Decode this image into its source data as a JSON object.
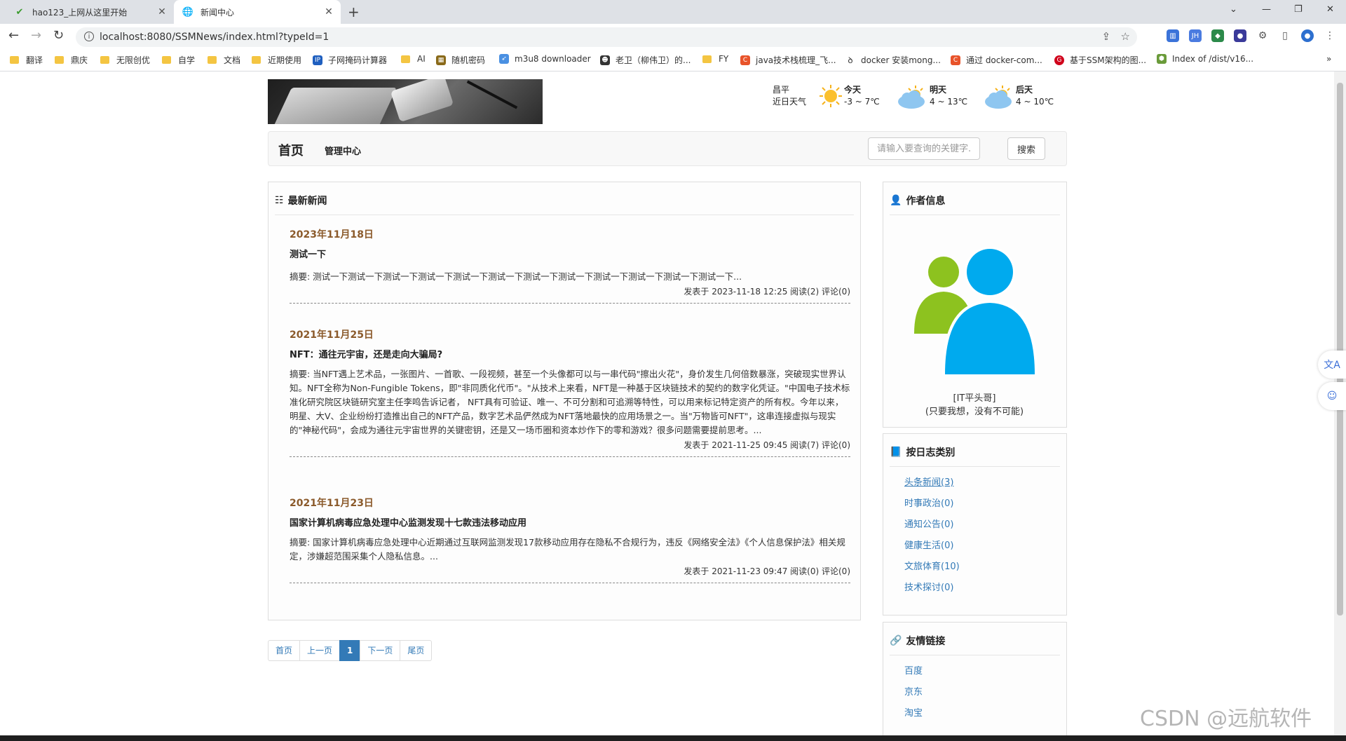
{
  "browser": {
    "tabs": [
      {
        "title": "hao123_上网从这里开始",
        "active": false
      },
      {
        "title": "新闻中心",
        "active": true
      }
    ],
    "url": "localhost:8080/SSMNews/index.html?typeId=1",
    "bookmarks": [
      "翻译",
      "鼎庆",
      "无限创优",
      "自学",
      "文档",
      "近期使用",
      "子网掩码计算器",
      "AI",
      "随机密码",
      "m3u8 downloader",
      "老卫（柳伟卫）的...",
      "FY",
      "java技术栈梳理_飞...",
      "docker 安装mong...",
      "通过 docker-com...",
      "基于SSM架构的图...",
      "Index of /dist/v16..."
    ],
    "bookmark_more": "»"
  },
  "weather": {
    "location": "昌平",
    "subtitle": "近日天气",
    "days": [
      {
        "label": "今天",
        "range": "-3 ~ 7℃",
        "icon": "sun-icon"
      },
      {
        "label": "明天",
        "range": "4 ~ 13℃",
        "icon": "cloudy-icon"
      },
      {
        "label": "后天",
        "range": "4 ~ 10℃",
        "icon": "cloudy-icon"
      }
    ]
  },
  "nav": {
    "home": "首页",
    "admin": "管理中心",
    "search_placeholder": "请输入要查询的关键字...",
    "search_button": "搜索"
  },
  "latest": {
    "heading": "最新新闻",
    "items": [
      {
        "date": "2023年11月18日",
        "title": "测试一下",
        "summary": "摘要: 测试一下测试一下测试一下测试一下测试一下测试一下测试一下测试一下测试一下测试一下测试一下测试一下...",
        "meta": "发表于 2023-11-18 12:25 阅读(2) 评论(0)"
      },
      {
        "date": "2021年11月25日",
        "title": "NFT：通往元宇宙，还是走向大骗局?",
        "summary": "摘要: 当NFT遇上艺术品，一张图片、一首歌、一段视频，甚至一个头像都可以与一串代码\"擦出火花\"，身价发生几何倍数暴涨，突破现实世界认知。NFT全称为Non-Fungible Tokens，即\"非同质化代币\"。\"从技术上来看，NFT是一种基于区块链技术的契约的数字化凭证。\"中国电子技术标准化研究院区块链研究室主任李鸣告诉记者， NFT具有可验证、唯一、不可分割和可追溯等特性，可以用来标记特定资产的所有权。今年以来，明星、大V、企业纷纷打造推出自己的NFT产品，数字艺术品俨然成为NFT落地最快的应用场景之一。当\"万物皆可NFT\"，这串连接虚拟与现实的\"神秘代码\"，会成为通往元宇宙世界的关键密钥，还是又一场币圈和资本炒作下的零和游戏？很多问题需要提前思考。...",
        "meta": "发表于 2021-11-25 09:45 阅读(7) 评论(0)"
      },
      {
        "date": "2021年11月23日",
        "title": "国家计算机病毒应急处理中心监测发现十七款违法移动应用",
        "summary": "摘要: 国家计算机病毒应急处理中心近期通过互联网监测发现17款移动应用存在隐私不合规行为，违反《网络安全法》《个人信息保护法》相关规定，涉嫌超范围采集个人隐私信息。...",
        "meta": "发表于 2021-11-23 09:47 阅读(0) 评论(0)"
      }
    ]
  },
  "pager": {
    "first": "首页",
    "prev": "上一页",
    "current": "1",
    "next": "下一页",
    "last": "尾页"
  },
  "author": {
    "heading": "作者信息",
    "name": "[IT平头哥]",
    "motto": "(只要我想，没有不可能)"
  },
  "categories": {
    "heading": "按日志类别",
    "items": [
      "头条新闻(3)",
      "时事政治(0)",
      "通知公告(0)",
      "健康生活(0)",
      "文旅体育(10)",
      "技术探讨(0)"
    ]
  },
  "links": {
    "heading": "友情链接",
    "items": [
      "百度",
      "京东",
      "淘宝"
    ]
  },
  "watermark": "CSDN @远航软件",
  "colors": {
    "link": "#337ab7",
    "date": "#8b5a2b",
    "avatar_green": "#8dc21f",
    "avatar_blue": "#00aaee"
  }
}
